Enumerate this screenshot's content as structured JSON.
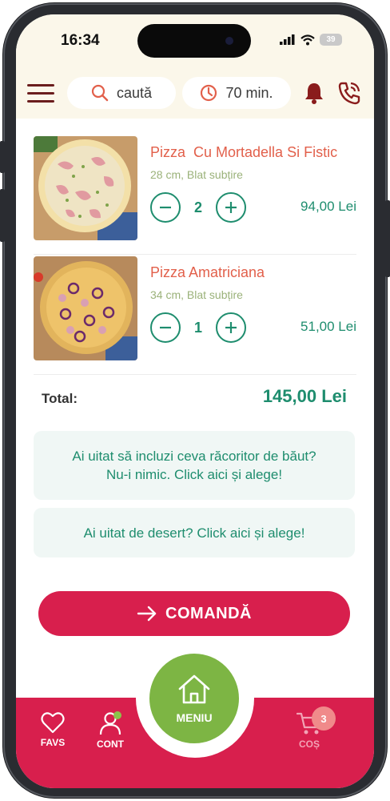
{
  "status_bar": {
    "time": "16:34",
    "battery": "39"
  },
  "header": {
    "search_label": "caută",
    "delivery_time": "70 min."
  },
  "cart": {
    "items": [
      {
        "name": "Pizza  Cu Mortadella Si Fistic",
        "detail": "28 cm, Blat subțire",
        "quantity": "2",
        "price": "94,00 Lei"
      },
      {
        "name": "Pizza Amatriciana",
        "detail": "34 cm, Blat subțire",
        "quantity": "1",
        "price": "51,00 Lei"
      }
    ],
    "total_label": "Total:",
    "total_value": "145,00 Lei"
  },
  "suggestions": {
    "drinks_line1": "Ai uitat să incluzi ceva răcoritor de băut?",
    "drinks_line2": "Nu-i nimic. Click aici și alege!",
    "dessert": "Ai uitat de desert? Click aici și alege!"
  },
  "order_button": "COMANDĂ",
  "bottom_nav": {
    "favs": "FAVS",
    "cont": "CONT",
    "menu": "MENIU",
    "cos": "COȘ",
    "cart_count": "3"
  },
  "colors": {
    "accent_red": "#d81f4d",
    "accent_green": "#1e8d6e",
    "menu_green": "#7db544",
    "item_name": "#e2604b",
    "header_bg": "#fbf7ea"
  }
}
